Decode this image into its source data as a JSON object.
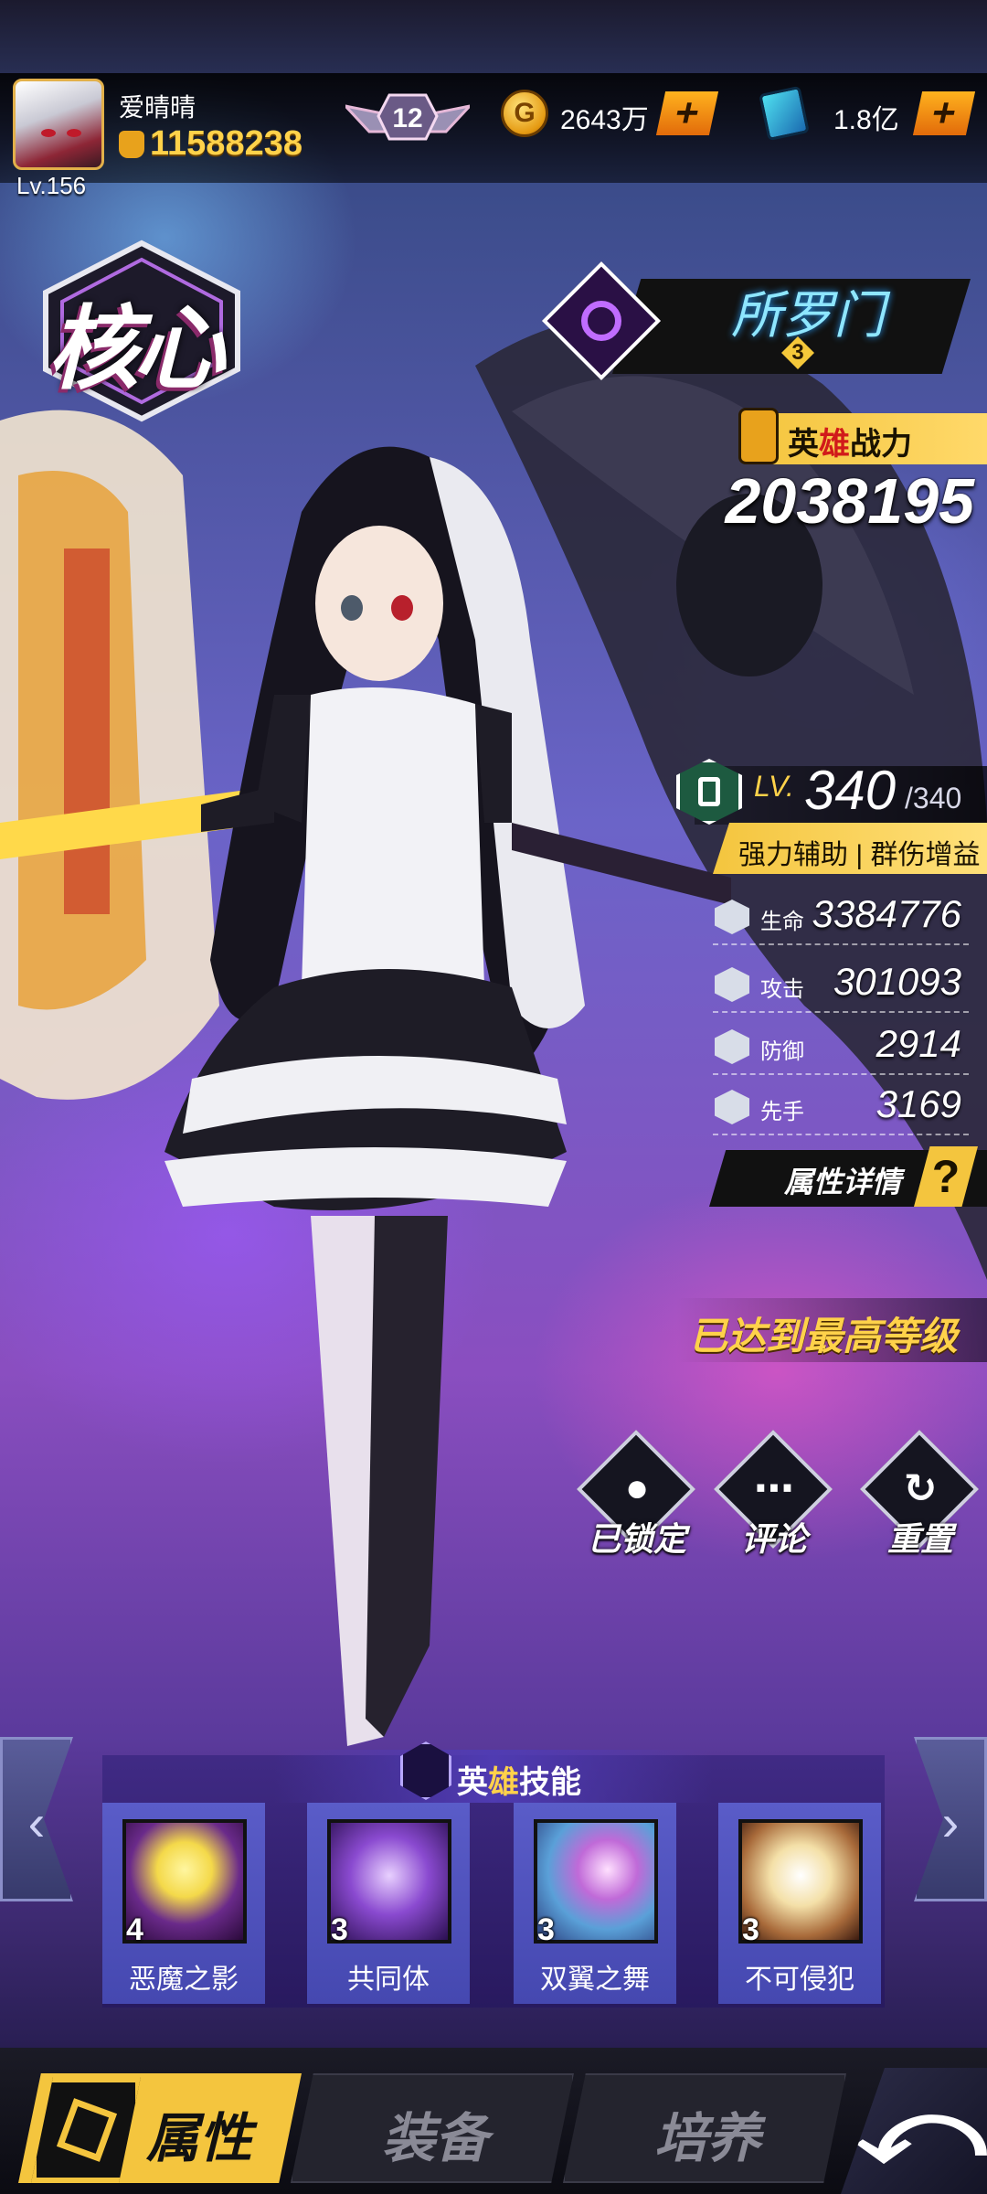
{
  "player": {
    "name": "爱晴晴",
    "level": "Lv.156",
    "power": "11588238",
    "rank": "12"
  },
  "resources": {
    "gold": "2643万",
    "gems": "1.8亿",
    "add_symbol": "+"
  },
  "badge": {
    "core": "核心"
  },
  "hero": {
    "name": "所罗门",
    "stars": "3",
    "combat_power_label_a": "英",
    "combat_power_label_b": "雄",
    "combat_power_label_c": "战力",
    "combat_power": "2038195",
    "level_prefix": "LV.",
    "level": "340",
    "level_max": "/340",
    "role": "强力辅助 | 群伤增益"
  },
  "stats": [
    {
      "label": "生命",
      "value": "3384776",
      "icon": "heart-shield-icon"
    },
    {
      "label": "攻击",
      "value": "301093",
      "icon": "crossed-swords-icon"
    },
    {
      "label": "防御",
      "value": "2914",
      "icon": "shield-icon"
    },
    {
      "label": "先手",
      "value": "3169",
      "icon": "speed-icon"
    }
  ],
  "attr_detail": {
    "label": "属性详情",
    "help": "?"
  },
  "max_level_notice": "已达到最高等级",
  "actions": {
    "lock": "已锁定",
    "comment": "评论",
    "reset": "重置"
  },
  "skills": {
    "title_a": "英",
    "title_b": "雄",
    "title_c": "技能",
    "items": [
      {
        "name": "恶魔之影",
        "level": "4",
        "color": "#f4d94a"
      },
      {
        "name": "共同体",
        "level": "3",
        "color": "#8a4ad0"
      },
      {
        "name": "双翼之舞",
        "level": "3",
        "color": "#9a6ad8"
      },
      {
        "name": "不可侵犯",
        "level": "3",
        "color": "#f4e0a8"
      }
    ]
  },
  "nav": {
    "attributes": "属性",
    "equipment": "装备",
    "training": "培养"
  },
  "colors": {
    "accent_gold": "#f4c53e",
    "hero_name": "#8ee6ff",
    "skill_panel": "#4548b0"
  }
}
